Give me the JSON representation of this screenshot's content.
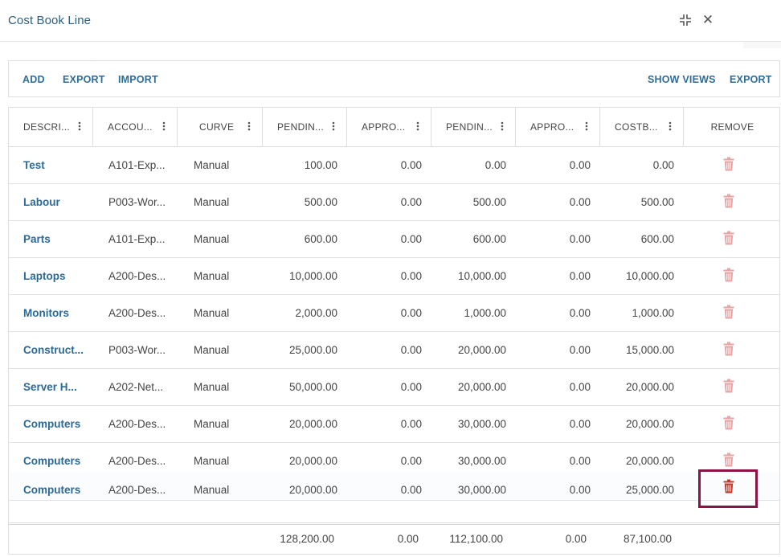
{
  "window": {
    "title": "Cost Book Line",
    "compress_icon": "compress-icon",
    "close_glyph": "✕"
  },
  "toolbar": {
    "add_label": "ADD",
    "export_label": "EXPORT",
    "import_label": "IMPORT",
    "show_views_label": "SHOW VIEWS",
    "export_right_label": "EXPORT"
  },
  "columns": [
    {
      "label": "DESCRI..."
    },
    {
      "label": "ACCOU..."
    },
    {
      "label": "CURVE"
    },
    {
      "label": "PENDIN..."
    },
    {
      "label": "APPRO..."
    },
    {
      "label": "PENDIN..."
    },
    {
      "label": "APPRO..."
    },
    {
      "label": "COSTB..."
    },
    {
      "label": "REMOVE"
    }
  ],
  "rows": [
    {
      "description": "Test",
      "account": "A101-Exp...",
      "curve": "Manual",
      "c1": "100.00",
      "c2": "0.00",
      "c3": "0.00",
      "c4": "0.00",
      "c5": "0.00"
    },
    {
      "description": "Labour",
      "account": "P003-Wor...",
      "curve": "Manual",
      "c1": "500.00",
      "c2": "0.00",
      "c3": "500.00",
      "c4": "0.00",
      "c5": "500.00"
    },
    {
      "description": "Parts",
      "account": "A101-Exp...",
      "curve": "Manual",
      "c1": "600.00",
      "c2": "0.00",
      "c3": "600.00",
      "c4": "0.00",
      "c5": "600.00"
    },
    {
      "description": "Laptops",
      "account": "A200-Des...",
      "curve": "Manual",
      "c1": "10,000.00",
      "c2": "0.00",
      "c3": "10,000.00",
      "c4": "0.00",
      "c5": "10,000.00"
    },
    {
      "description": "Monitors",
      "account": "A200-Des...",
      "curve": "Manual",
      "c1": "2,000.00",
      "c2": "0.00",
      "c3": "1,000.00",
      "c4": "0.00",
      "c5": "1,000.00"
    },
    {
      "description": "Construct...",
      "account": "P003-Wor...",
      "curve": "Manual",
      "c1": "25,000.00",
      "c2": "0.00",
      "c3": "20,000.00",
      "c4": "0.00",
      "c5": "15,000.00"
    },
    {
      "description": "Server H...",
      "account": "A202-Net...",
      "curve": "Manual",
      "c1": "50,000.00",
      "c2": "0.00",
      "c3": "20,000.00",
      "c4": "0.00",
      "c5": "20,000.00"
    },
    {
      "description": "Computers",
      "account": "A200-Des...",
      "curve": "Manual",
      "c1": "20,000.00",
      "c2": "0.00",
      "c3": "30,000.00",
      "c4": "0.00",
      "c5": "20,000.00"
    },
    {
      "description": "Computers",
      "account": "A200-Des...",
      "curve": "Manual",
      "c1": "20,000.00",
      "c2": "0.00",
      "c3": "30,000.00",
      "c4": "0.00",
      "c5": "20,000.00"
    },
    {
      "description": "Computers",
      "account": "A200-Des...",
      "curve": "Manual",
      "c1": "20,000.00",
      "c2": "0.00",
      "c3": "30,000.00",
      "c4": "0.00",
      "c5": "25,000.00"
    }
  ],
  "totals": {
    "c1": "128,200.00",
    "c2": "0.00",
    "c3": "112,100.00",
    "c4": "0.00",
    "c5": "87,100.00"
  },
  "colors": {
    "accent": "#2b6a96",
    "trash_faded": "#e8a4a4",
    "trash_active": "#c0392b",
    "highlight": "#8b1446"
  },
  "icons": {
    "row_remove": "trash-icon",
    "column_menu": "kebab-menu-icon"
  }
}
